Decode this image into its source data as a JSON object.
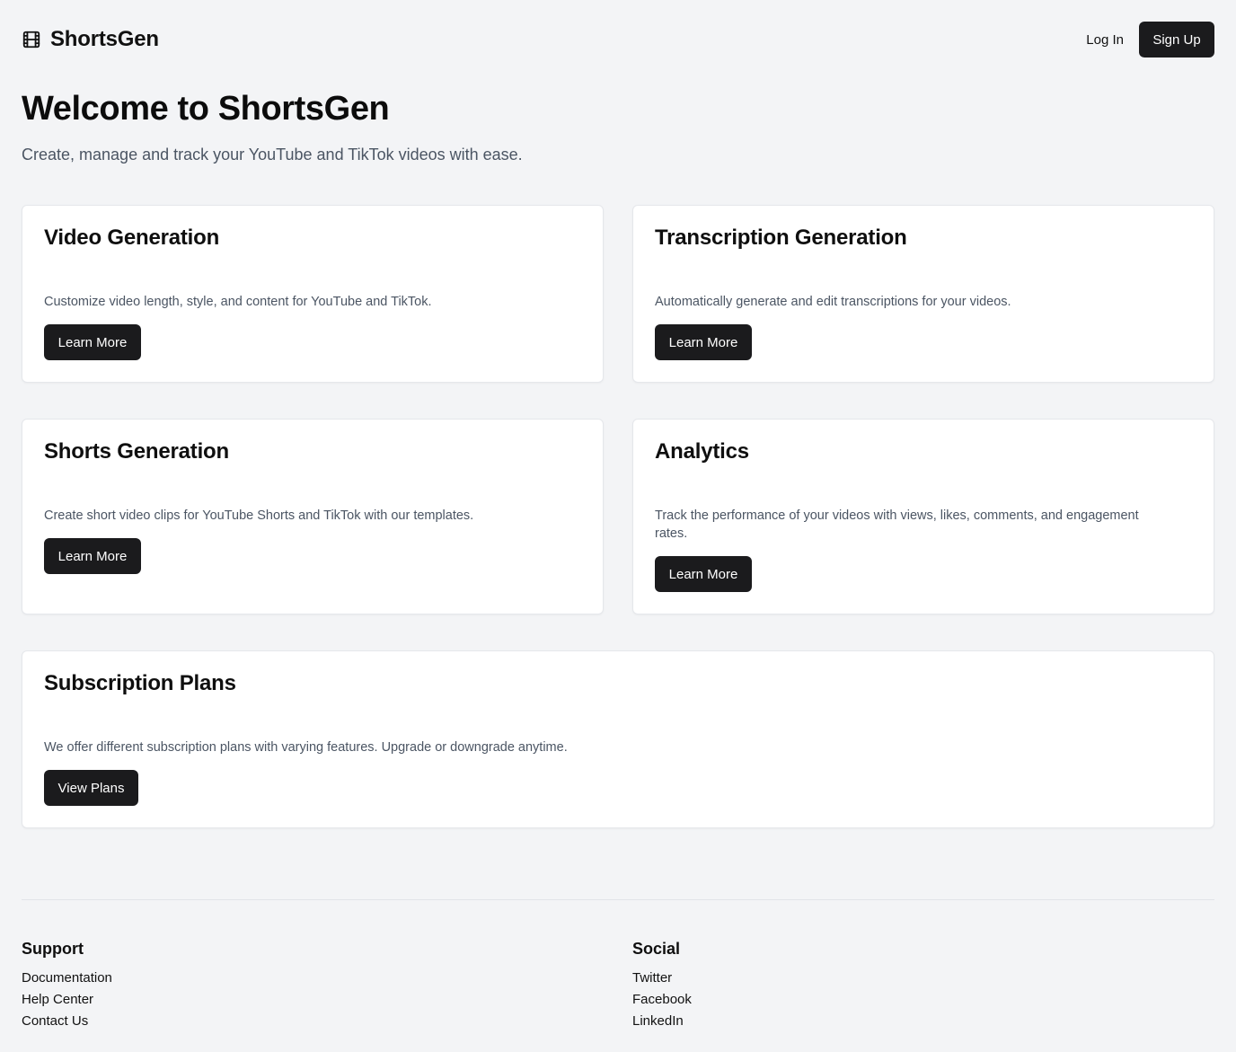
{
  "header": {
    "brand_name": "ShortsGen",
    "brand_icon": "film-icon",
    "login_label": "Log In",
    "signup_label": "Sign Up"
  },
  "hero": {
    "title": "Welcome to ShortsGen",
    "subtitle": "Create, manage and track your YouTube and TikTok videos with ease."
  },
  "cards": [
    {
      "title": "Video Generation",
      "description": "Customize video length, style, and content for YouTube and TikTok.",
      "button_label": "Learn More"
    },
    {
      "title": "Transcription Generation",
      "description": "Automatically generate and edit transcriptions for your videos.",
      "button_label": "Learn More"
    },
    {
      "title": "Shorts Generation",
      "description": "Create short video clips for YouTube Shorts and TikTok with our templates.",
      "button_label": "Learn More"
    },
    {
      "title": "Analytics",
      "description": "Track the performance of your videos with views, likes, comments, and engagement rates.",
      "button_label": "Learn More"
    },
    {
      "title": "Subscription Plans",
      "description": "We offer different subscription plans with varying features. Upgrade or downgrade anytime.",
      "button_label": "View Plans"
    }
  ],
  "footer": {
    "support": {
      "heading": "Support",
      "links": [
        "Documentation",
        "Help Center",
        "Contact Us"
      ]
    },
    "social": {
      "heading": "Social",
      "links": [
        "Twitter",
        "Facebook",
        "LinkedIn"
      ]
    }
  },
  "colors": {
    "background": "#f3f4f6",
    "card_background": "#ffffff",
    "primary_button": "#1b1b1d",
    "muted_text": "#4b5563"
  }
}
